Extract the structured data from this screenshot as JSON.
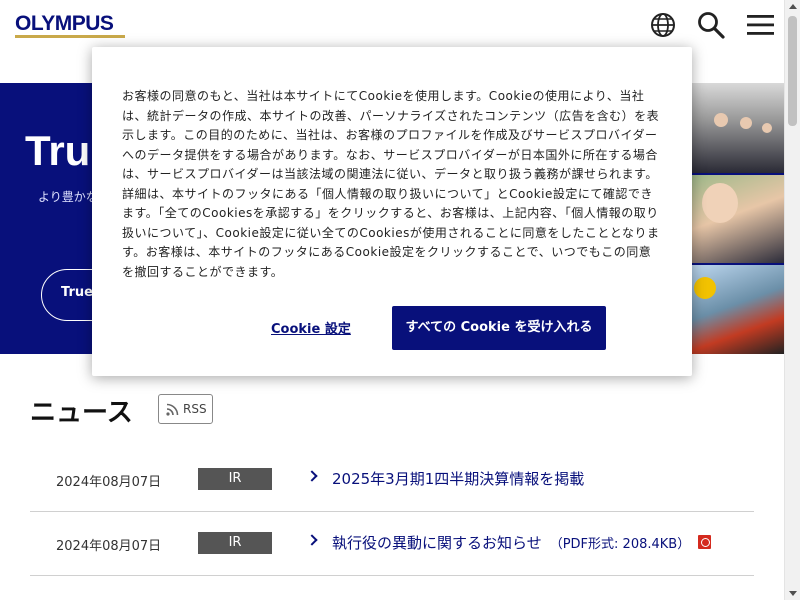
{
  "header": {
    "logo_text": "OLYMPUS",
    "icons": [
      "globe-icon",
      "search-icon",
      "menu-icon"
    ]
  },
  "hero": {
    "title": "True",
    "subtitle": "より豊かな",
    "button_label": "True"
  },
  "news": {
    "title": "ニュース",
    "rss_label": "RSS",
    "items": [
      {
        "date": "2024年08月07日",
        "tag": "IR",
        "text": "2025年3月期1四半期決算情報を掲載",
        "meta": ""
      },
      {
        "date": "2024年08月07日",
        "tag": "IR",
        "text": "執行役の異動に関するお知らせ",
        "meta": "（PDF形式: 208.4KB）"
      }
    ]
  },
  "cookie_dialog": {
    "body": "お客様の同意のもと、当社は本サイトにてCookieを使用します。Cookieの使用により、当社は、統計データの作成、本サイトの改善、パーソナライズされたコンテンツ（広告を含む）を表示します。この目的のために、当社は、お客様のプロファイルを作成及びサービスプロバイダーへのデータ提供をする場合があります。なお、サービスプロバイダーが日本国外に所在する場合は、サービスプロバイダーは当該法域の関連法に従い、データと取り扱う義務が課せられます。詳細は、本サイトのフッタにある「個人情報の取り扱いについて」とCookie設定にて確認できます。「全てのCookiesを承認する」をクリックすると、お客様は、上記内容、「個人情報の取り扱いについて」、Cookie設定に従い全てのCookiesが使用されることに同意をしたこととなります。お客様は、本サイトのフッタにあるCookie設定をクリックすることで、いつでもこの同意を撤回することができます。",
    "settings_label": "Cookie 設定",
    "accept_label": "すべての Cookie を受け入れる"
  },
  "colors": {
    "brand": "#08107b",
    "accent": "#c9a94a",
    "tag_bg": "#555555",
    "pdf": "#d42a1e"
  }
}
